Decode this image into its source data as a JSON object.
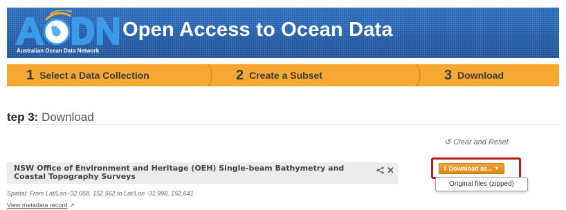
{
  "header": {
    "logo_text": "AODN",
    "logo_subtitle": "Australian Ocean Data Network",
    "title": "Open Access to Ocean Data",
    "colors": {
      "banner": "#1f5aa6",
      "logo_accent": "#f7a833"
    }
  },
  "steps": [
    {
      "number": "1",
      "label": "Select a Data Collection"
    },
    {
      "number": "2",
      "label": "Create a Subset"
    },
    {
      "number": "3",
      "label": "Download"
    }
  ],
  "step_heading": {
    "prefix": "tep 3:",
    "text": "Download"
  },
  "clear_reset": {
    "icon": "undo-icon",
    "label": "Clear and Reset"
  },
  "collection": {
    "title": "NSW Office of Environment and Heritage (OEH) Single-beam Bathymetry and Coastal Topography Surveys",
    "share_icon": "share-icon",
    "close_icon": "close-icon",
    "spatial": "Spatial: From Lat/Lon -32.058, 152.562 to Lat/Lon -31.998, 152.641",
    "metadata_link": "View metadata record"
  },
  "download": {
    "button_label": "Download as...",
    "button_icon": "download-icon",
    "options": [
      "Original files (zipped)"
    ],
    "accent": "#f7a833",
    "highlight": "#b81c1c"
  }
}
